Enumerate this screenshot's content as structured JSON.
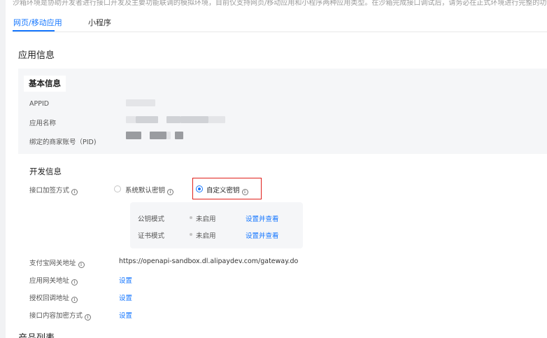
{
  "notice": "沙箱环境是协助开发者进行接口开发及主要功能联调的模拟环境，目前仅支持网页/移动应用和小程序两种应用类型。在沙箱完成接口调试后，请务必在正式环境进行完整的功能验收测试。",
  "tabs": [
    {
      "label": "网页/移动应用",
      "active": true
    },
    {
      "label": "小程序",
      "active": false
    }
  ],
  "app_info": {
    "title": "应用信息",
    "basic": {
      "title": "基本信息",
      "fields": [
        {
          "label": "APPID"
        },
        {
          "label": "应用名称"
        },
        {
          "label": "绑定的商家账号（PID)"
        }
      ]
    }
  },
  "dev_info": {
    "title": "开发信息",
    "sign_method": {
      "label": "接口加签方式",
      "options": [
        {
          "label": "系统默认密钥",
          "checked": false
        },
        {
          "label": "自定义密钥",
          "checked": true
        }
      ]
    },
    "key_modes": [
      {
        "label": "公钥模式",
        "status": "未启用",
        "action": "设置并查看"
      },
      {
        "label": "证书模式",
        "status": "未启用",
        "action": "设置并查看"
      }
    ],
    "rows": [
      {
        "label": "支付宝网关地址",
        "value": "https://openapi-sandbox.dl.alipaydev.com/gateway.do"
      },
      {
        "label": "应用网关地址",
        "link": "设置"
      },
      {
        "label": "授权回调地址",
        "link": "设置"
      },
      {
        "label": "接口内容加密方式",
        "link": "设置"
      }
    ]
  },
  "product_list": {
    "title": "产品列表"
  },
  "colors": {
    "accent": "#1677ff",
    "highlight": "#e0201b",
    "panel": "#f5f6f8"
  }
}
